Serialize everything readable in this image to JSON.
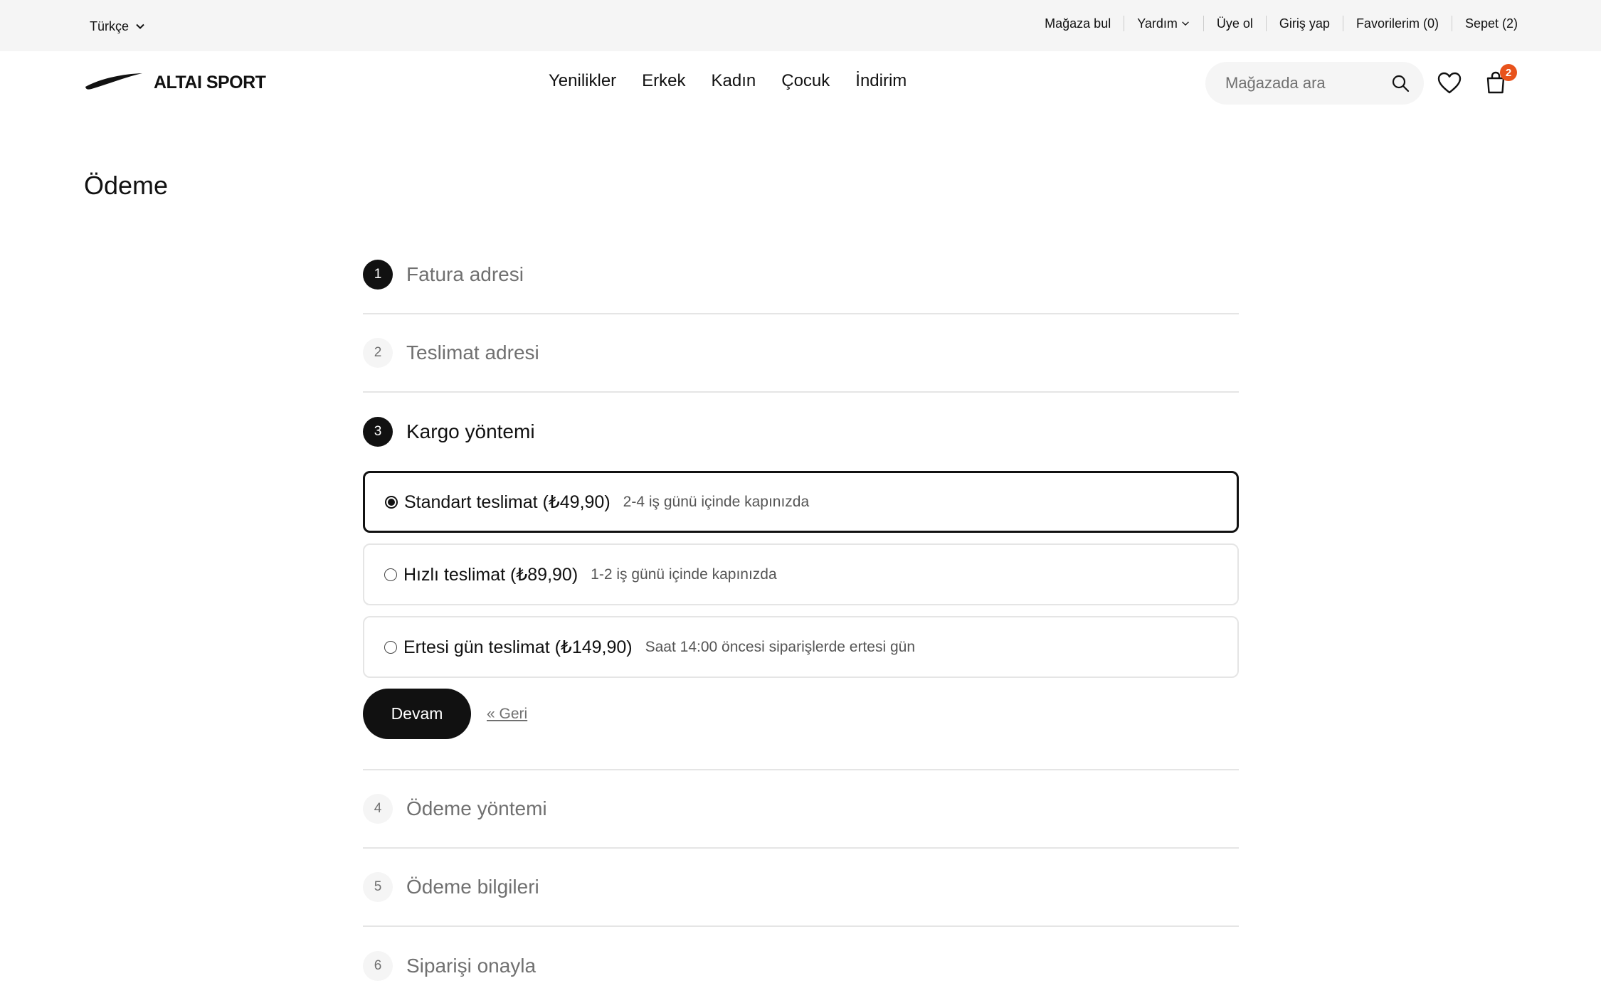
{
  "utility_bar": {
    "language": "Türkçe",
    "links": [
      {
        "label": "Mağaza bul"
      },
      {
        "label": "Yardım"
      },
      {
        "label": "Üye ol"
      },
      {
        "label": "Giriş yap"
      },
      {
        "label": "Favorilerim (0)"
      },
      {
        "label": "Sepet (2)"
      }
    ]
  },
  "header": {
    "brand": "ALTAI SPORT",
    "nav": [
      "Yenilikler",
      "Erkek",
      "Kadın",
      "Çocuk",
      "İndirim"
    ],
    "search_placeholder": "Mağazada ara",
    "cart_count": "2",
    "badge_color": "#e8531c"
  },
  "page": {
    "title": "Ödeme"
  },
  "steps": [
    {
      "number": "1",
      "title": "Fatura adresi",
      "state": "completed"
    },
    {
      "number": "2",
      "title": "Teslimat adresi",
      "state": "inactive"
    },
    {
      "number": "3",
      "title": "Kargo yöntemi",
      "state": "active"
    },
    {
      "number": "4",
      "title": "Ödeme yöntemi",
      "state": "inactive"
    },
    {
      "number": "5",
      "title": "Ödeme bilgileri",
      "state": "inactive"
    },
    {
      "number": "6",
      "title": "Siparişi onayla",
      "state": "inactive"
    }
  ],
  "shipping_options": [
    {
      "name": "Standart teslimat (₺49,90)",
      "description": "2-4 iş günü içinde kapınızda",
      "selected": true
    },
    {
      "name": "Hızlı teslimat (₺89,90)",
      "description": "1-2 iş günü içinde kapınızda",
      "selected": false
    },
    {
      "name": "Ertesi gün teslimat (₺149,90)",
      "description": "Saat 14:00 öncesi siparişlerde ertesi gün",
      "selected": false
    }
  ],
  "actions": {
    "continue_label": "Devam",
    "back_label": "« Geri"
  }
}
